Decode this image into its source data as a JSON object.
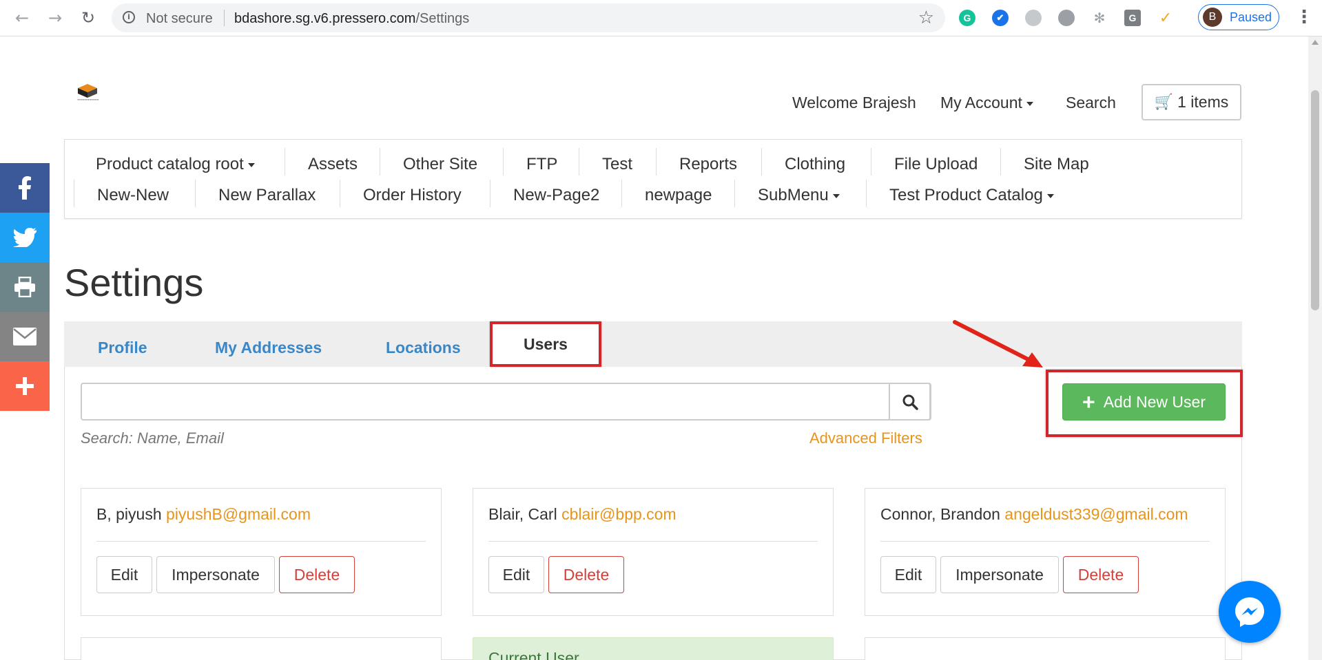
{
  "browser": {
    "security_label": "Not secure",
    "url_host": "bdashore.sg.v6.pressero.com",
    "url_path": "/Settings",
    "profile_initial": "B",
    "profile_status": "Paused"
  },
  "header": {
    "welcome": "Welcome  Brajesh",
    "my_account": "My Account",
    "search": "Search",
    "cart": "1 items"
  },
  "menu": {
    "row1": [
      "Product catalog root",
      "Assets",
      "Other Site",
      "FTP",
      "Test",
      "Reports",
      "Clothing",
      "File Upload",
      "Site Map"
    ],
    "row2": [
      "New-New",
      "New Parallax",
      "Order History",
      "New-Page2",
      "newpage",
      "SubMenu",
      "Test Product Catalog"
    ]
  },
  "page": {
    "title": "Settings",
    "tabs": [
      "Profile",
      "My Addresses",
      "Locations",
      "Users"
    ],
    "active_tab": "Users",
    "search_hint": "Search: Name, Email",
    "advanced_filters": "Advanced Filters",
    "add_new_user": "Add New User"
  },
  "users": [
    {
      "name": "B, piyush",
      "email": "piyushB@gmail.com"
    },
    {
      "name": "Blair, Carl",
      "email": "cblair@bpp.com"
    },
    {
      "name": "Connor, Brandon",
      "email": "angeldust339@gmail.com"
    }
  ],
  "buttons": {
    "edit": "Edit",
    "impersonate": "Impersonate",
    "delete": "Delete"
  },
  "current_user_label": "Current User",
  "colors": {
    "link_blue": "#3a87c8",
    "orange": "#e8941a",
    "green": "#5cb85c",
    "red_annotation": "#d3262c",
    "facebook": "#3b5998",
    "twitter": "#1da1f2",
    "print": "#6d8589",
    "email": "#848484",
    "share": "#fa6449"
  }
}
